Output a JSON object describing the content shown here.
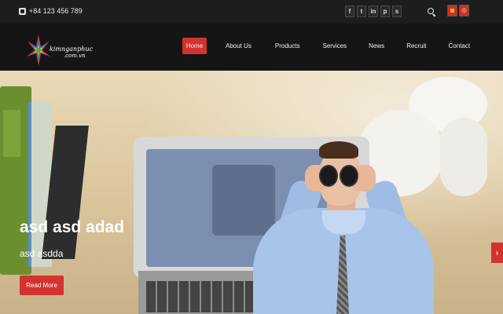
{
  "topbar": {
    "phone": "+84 123 456 789",
    "socials": [
      {
        "name": "facebook",
        "glyph": "f"
      },
      {
        "name": "twitter",
        "glyph": "t"
      },
      {
        "name": "linkedin",
        "glyph": "in"
      },
      {
        "name": "pinterest",
        "glyph": "p"
      },
      {
        "name": "skype",
        "glyph": "s"
      }
    ],
    "languages": [
      "Vietnamese",
      "Chinese"
    ]
  },
  "logo": {
    "text": "kimnganphuc",
    "sub": ".com.vn"
  },
  "nav": {
    "items": [
      "Home",
      "About Us",
      "Products",
      "Services",
      "News",
      "Recruit",
      "Contact"
    ],
    "active": "Home"
  },
  "hero": {
    "title": "asd asd adad",
    "subtitle": "asd asdda",
    "button": "Read More",
    "next_glyph": "›"
  },
  "colors": {
    "accent": "#d2332f",
    "topbar": "#1d1d1d",
    "navbar": "#151515"
  }
}
